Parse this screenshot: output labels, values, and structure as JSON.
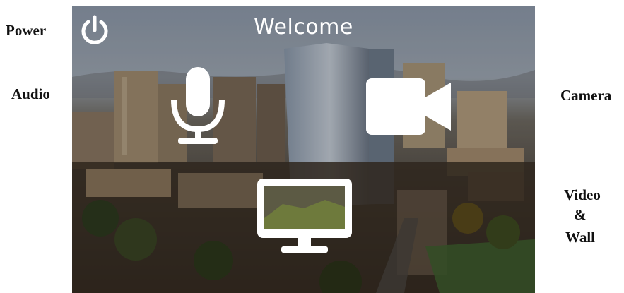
{
  "labels": {
    "power": "Power",
    "audio": "Audio",
    "camera": "Camera",
    "video": "Video",
    "ampersand": "&",
    "wall": "Wall"
  },
  "panel": {
    "title": "Welcome"
  },
  "icons": {
    "power": "power-icon",
    "audio": "microphone-icon",
    "camera": "video-camera-icon",
    "display": "monitor-icon"
  },
  "colors": {
    "icon": "#ffffff",
    "label": "#111111"
  }
}
